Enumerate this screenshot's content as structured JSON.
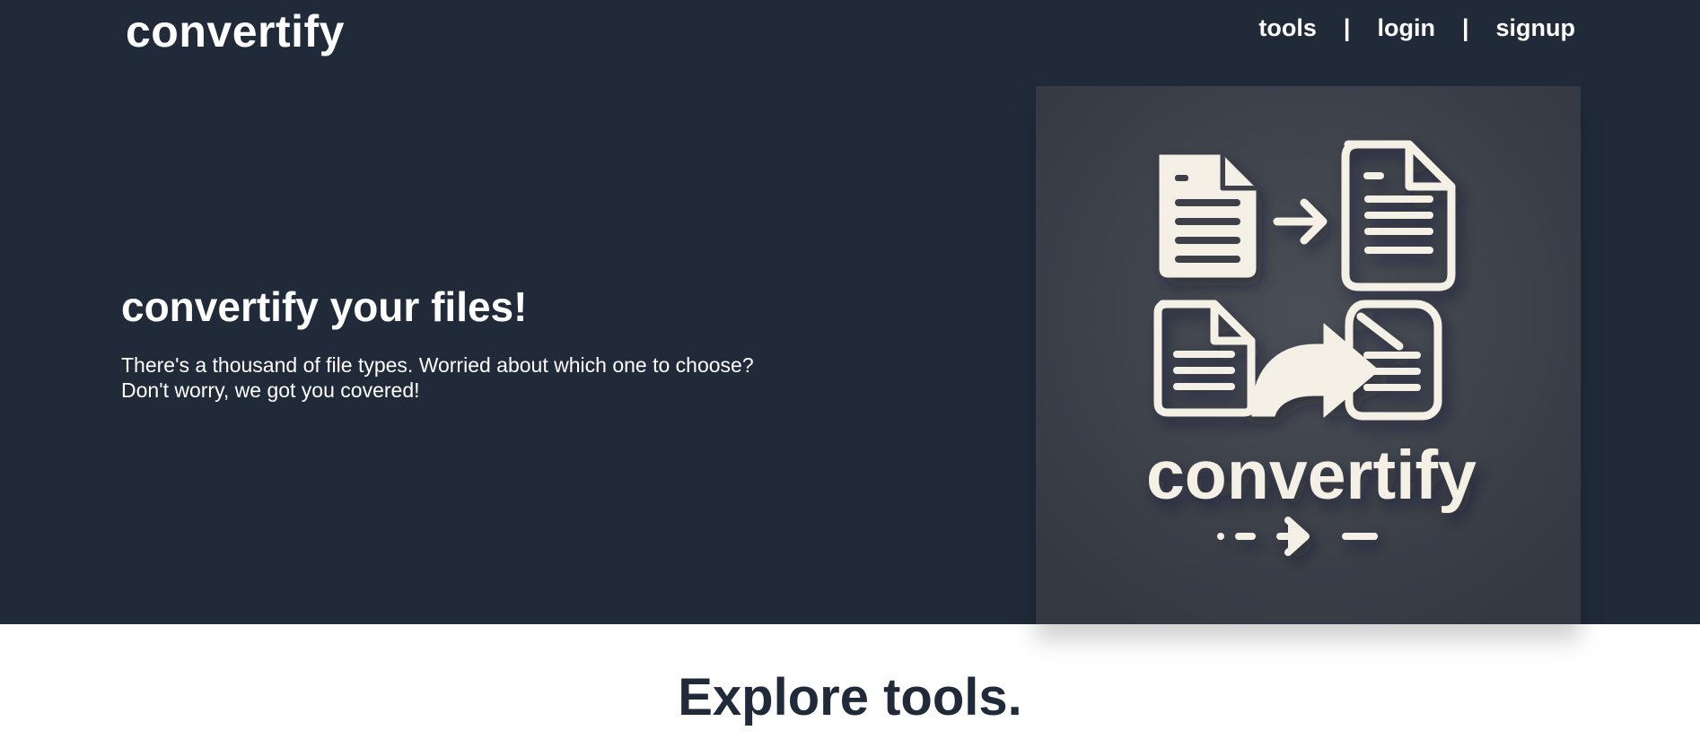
{
  "brand": {
    "name": "convertify"
  },
  "nav": {
    "items": [
      {
        "label": "tools"
      },
      {
        "separator": "|"
      },
      {
        "label": "login"
      },
      {
        "separator": "|"
      },
      {
        "label": "signup"
      }
    ]
  },
  "hero": {
    "title": "convertify your files!",
    "description_line_1": "There's a thousand of file types. Worried about which one to choose?",
    "description_line_2": "Don't worry, we got you covered!",
    "illustration": {
      "logo_text": "convertify",
      "icon_names": [
        "document-icon",
        "arrow-right-icon",
        "document-icon",
        "document-icon",
        "curved-arrow-icon",
        "document-icon",
        "dashed-arrow-icon"
      ],
      "colors": {
        "panel": "#3c404a",
        "icon": "#f4f0e6"
      }
    }
  },
  "section": {
    "title": "Explore tools."
  },
  "colors": {
    "hero_background": "#212a39",
    "page_background": "#ffffff",
    "text_light": "#ffffff",
    "text_dark": "#212a39"
  }
}
